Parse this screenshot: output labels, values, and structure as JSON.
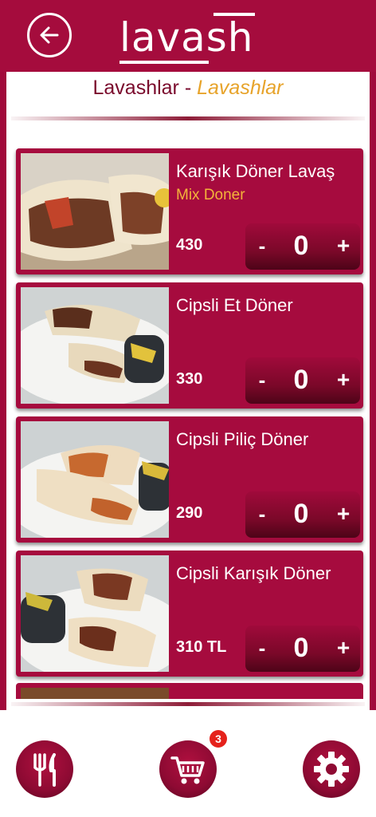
{
  "header": {
    "logo_text": "lavash",
    "back_icon": "arrow-left-icon"
  },
  "category": {
    "title": "Lavashlar",
    "separator": " - ",
    "subtitle": "Lavashlar"
  },
  "products": [
    {
      "name": "Karışık Döner Lavaş",
      "subname": "Mix Doner",
      "price": "430",
      "quantity": "0",
      "minus_label": "-",
      "plus_label": "+"
    },
    {
      "name": "Cipsli Et Döner",
      "subname": "",
      "price": "330",
      "quantity": "0",
      "minus_label": "-",
      "plus_label": "+"
    },
    {
      "name": "Cipsli Piliç Döner",
      "subname": "",
      "price": "290",
      "quantity": "0",
      "minus_label": "-",
      "plus_label": "+"
    },
    {
      "name": "Cipsli Karışık Döner",
      "subname": "",
      "price": "310 TL",
      "quantity": "0",
      "minus_label": "-",
      "plus_label": "+"
    }
  ],
  "bottom_nav": {
    "menu_icon": "fork-knife-icon",
    "cart_icon": "cart-icon",
    "cart_badge": "3",
    "settings_icon": "gear-icon"
  },
  "colors": {
    "brand": "#a50c3d",
    "accent_text": "#e7a32a",
    "badge": "#e5221b"
  }
}
